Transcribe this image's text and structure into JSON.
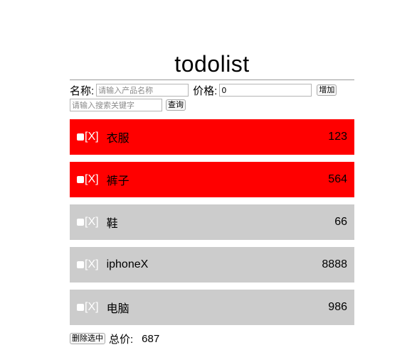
{
  "title": "todolist",
  "form": {
    "name_label": "名称:",
    "name_placeholder": "请输入产品名称",
    "price_label": "价格:",
    "price_value": "0",
    "add_label": "增加"
  },
  "search": {
    "placeholder": "请输入搜索关键字",
    "button_label": "查询"
  },
  "items": [
    {
      "delete": "[X]",
      "name": "衣服",
      "price": "123",
      "selected": true
    },
    {
      "delete": "[X]",
      "name": "裤子",
      "price": "564",
      "selected": true
    },
    {
      "delete": "[X]",
      "name": "鞋",
      "price": "66",
      "selected": false
    },
    {
      "delete": "[X]",
      "name": "iphoneX",
      "price": "8888",
      "selected": false
    },
    {
      "delete": "[X]",
      "name": "电脑",
      "price": "986",
      "selected": false
    }
  ],
  "footer": {
    "delete_selected_label": "删除选中",
    "total_label": "总价:",
    "total_value": "687"
  },
  "colors": {
    "selected_bg": "#ff0000",
    "unselected_bg": "#cccccc"
  }
}
